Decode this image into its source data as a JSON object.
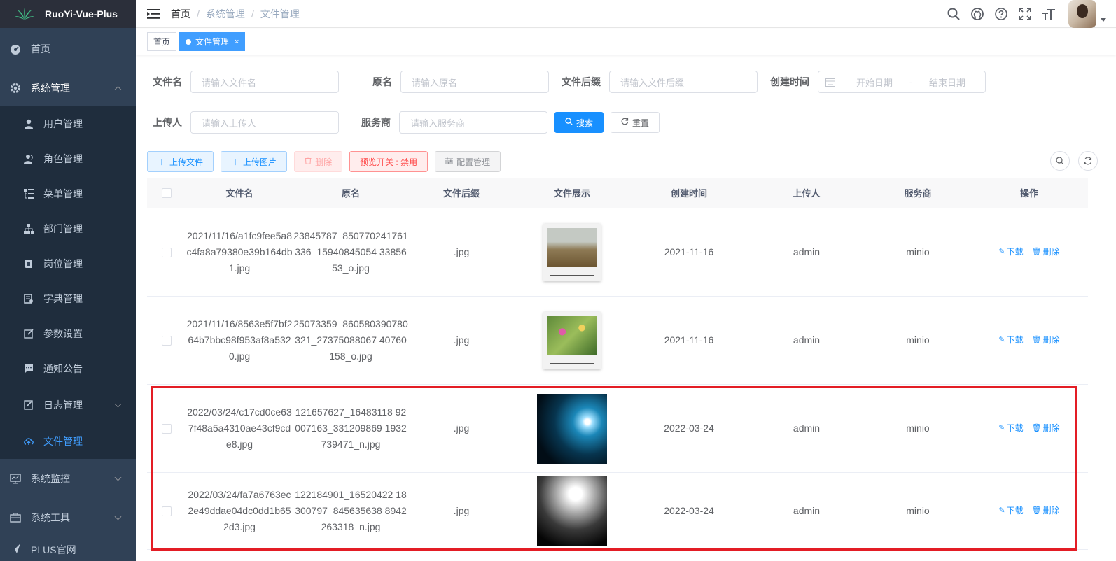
{
  "app": {
    "title": "RuoYi-Vue-Plus"
  },
  "sidebar": {
    "home": "首页",
    "system_mgmt": "系统管理",
    "sub_items": [
      {
        "label": "用户管理",
        "icon": "user-icon"
      },
      {
        "label": "角色管理",
        "icon": "peoples-icon"
      },
      {
        "label": "菜单管理",
        "icon": "tree-table-icon"
      },
      {
        "label": "部门管理",
        "icon": "tree-icon"
      },
      {
        "label": "岗位管理",
        "icon": "post-icon"
      },
      {
        "label": "字典管理",
        "icon": "dict-icon"
      },
      {
        "label": "参数设置",
        "icon": "edit-icon"
      },
      {
        "label": "通知公告",
        "icon": "message-icon"
      },
      {
        "label": "日志管理",
        "icon": "log-icon"
      },
      {
        "label": "文件管理",
        "icon": "upload-icon"
      }
    ],
    "monitor": "系统监控",
    "tools": "系统工具",
    "plus_site": "PLUS官网"
  },
  "breadcrumb": {
    "home": "首页",
    "level1": "系统管理",
    "level2": "文件管理"
  },
  "tags": {
    "home": "首页",
    "active": "文件管理",
    "close": "×"
  },
  "search": {
    "filename_label": "文件名",
    "filename_placeholder": "请输入文件名",
    "original_label": "原名",
    "original_placeholder": "请输入原名",
    "suffix_label": "文件后缀",
    "suffix_placeholder": "请输入文件后缀",
    "created_label": "创建时间",
    "start_placeholder": "开始日期",
    "range_sep": "-",
    "end_placeholder": "结束日期",
    "uploader_label": "上传人",
    "uploader_placeholder": "请输入上传人",
    "service_label": "服务商",
    "service_placeholder": "请输入服务商",
    "search_btn": "搜索",
    "reset_btn": "重置"
  },
  "toolbar": {
    "upload_file": "上传文件",
    "upload_image": "上传图片",
    "delete": "删除",
    "preview_switch": "预览开关 : 禁用",
    "config": "配置管理"
  },
  "table": {
    "headers": [
      "文件名",
      "原名",
      "文件后缀",
      "文件展示",
      "创建时间",
      "上传人",
      "服务商",
      "操作"
    ],
    "download": "下载",
    "delete": "删除",
    "rows": [
      {
        "filename": "2021/11/16/a1fc9fee5a8c4fa8a79380e39b164db1.jpg",
        "original": "23845787_850770241761336_15940845054 3385653_o.jpg",
        "suffix": ".jpg",
        "created": "2021-11-16",
        "uploader": "admin",
        "service": "minio",
        "image": "polaroid-field"
      },
      {
        "filename": "2021/11/16/8563e5f7bf264b7bbc98f953af8a5320.jpg",
        "original": "25073359_860580390780321_27375088067 40760158_o.jpg",
        "suffix": ".jpg",
        "created": "2021-11-16",
        "uploader": "admin",
        "service": "minio",
        "image": "polaroid-flowers"
      },
      {
        "filename": "2022/03/24/c17cd0ce637f48a5a4310ae43cf9cde8.jpg",
        "original": "121657627_16483118 92007163_331209869 1932739471_n.jpg",
        "suffix": ".jpg",
        "created": "2022-03-24",
        "uploader": "admin",
        "service": "minio",
        "image": "concert-blue"
      },
      {
        "filename": "2022/03/24/fa7a6763ec2e49ddae04dc0dd1b652d3.jpg",
        "original": "122184901_16520422 18300797_845635638 8942263318_n.jpg",
        "suffix": ".jpg",
        "created": "2022-03-24",
        "uploader": "admin",
        "service": "minio",
        "image": "concert-bw"
      }
    ]
  },
  "colors": {
    "sidebar_bg": "#304156",
    "primary": "#1890ff",
    "highlight": "#e31d25"
  }
}
